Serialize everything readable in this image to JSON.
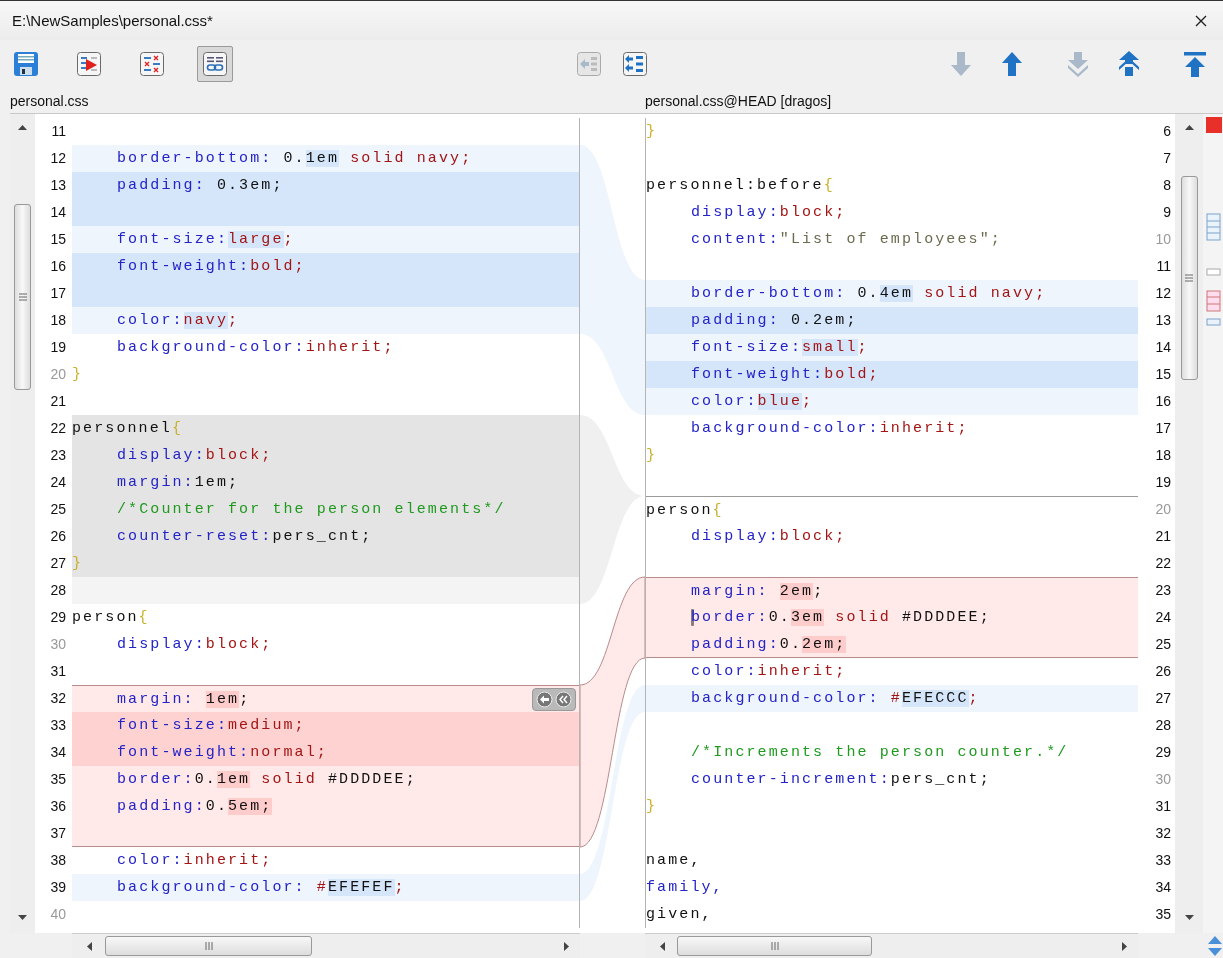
{
  "window": {
    "title": "E:\\NewSamples\\personal.css*"
  },
  "toolbar": {
    "groups": [
      {
        "buttons": [
          {
            "kind": "save",
            "pressed": false,
            "disabled": false
          },
          {
            "kind": "compare",
            "pressed": false,
            "disabled": false
          },
          {
            "kind": "ignore",
            "pressed": false,
            "disabled": false
          },
          {
            "kind": "link",
            "pressed": true,
            "disabled": false
          }
        ]
      },
      {
        "buttons": [
          {
            "kind": "copy-left",
            "pressed": false,
            "disabled": true
          },
          {
            "kind": "copy-all-left",
            "pressed": false,
            "disabled": false
          }
        ]
      },
      {
        "buttons": [
          {
            "kind": "next",
            "pressed": false,
            "disabled": true
          },
          {
            "kind": "prev",
            "pressed": false,
            "disabled": false
          },
          {
            "kind": "next-block",
            "pressed": false,
            "disabled": true
          },
          {
            "kind": "prev-block",
            "pressed": false,
            "disabled": false
          },
          {
            "kind": "first",
            "pressed": false,
            "disabled": false
          }
        ]
      }
    ]
  },
  "left": {
    "label": "personal.css",
    "lines": [
      {
        "number": "11",
        "kind": "plain"
      },
      {
        "number": "12",
        "kind": "change",
        "indent": true,
        "code": [
          {
            "text": "border-bottom:",
            "kind": "key"
          },
          {
            "text": " 0.",
            "kind": "num"
          },
          {
            "text": "1em",
            "kind": "num",
            "highlight": true
          },
          {
            "text": " solid navy;",
            "kind": "val"
          }
        ]
      },
      {
        "number": "13",
        "kind": "change-strong",
        "indent": true,
        "code": [
          {
            "text": "padding:",
            "kind": "key"
          },
          {
            "text": " 0.3em;",
            "kind": "num"
          }
        ]
      },
      {
        "number": "14",
        "kind": "change-strong"
      },
      {
        "number": "15",
        "kind": "change",
        "indent": true,
        "code": [
          {
            "text": "font-size:",
            "kind": "key"
          },
          {
            "text": "large",
            "kind": "val",
            "highlight": true
          },
          {
            "text": ";",
            "kind": "val"
          }
        ]
      },
      {
        "number": "16",
        "kind": "change-strong",
        "indent": true,
        "code": [
          {
            "text": "font-weight:",
            "kind": "key"
          },
          {
            "text": "bold;",
            "kind": "val"
          }
        ]
      },
      {
        "number": "17",
        "kind": "change-strong"
      },
      {
        "number": "18",
        "kind": "change",
        "indent": true,
        "code": [
          {
            "text": "color:",
            "kind": "key"
          },
          {
            "text": "navy",
            "kind": "val",
            "highlight": true
          },
          {
            "text": ";",
            "kind": "val"
          }
        ]
      },
      {
        "number": "19",
        "kind": "plain",
        "indent": true,
        "code": [
          {
            "text": "background-color:",
            "kind": "key"
          },
          {
            "text": "inherit;",
            "kind": "val"
          }
        ]
      },
      {
        "number": "20",
        "kind": "plain",
        "dim": true,
        "code": [
          {
            "text": "}",
            "kind": "brace"
          }
        ]
      },
      {
        "number": "21",
        "kind": "plain"
      },
      {
        "number": "22",
        "kind": "grey",
        "code": [
          {
            "text": "personnel",
            "kind": "sel"
          },
          {
            "text": "{",
            "kind": "brace"
          }
        ]
      },
      {
        "number": "23",
        "kind": "grey",
        "indent": true,
        "code": [
          {
            "text": "display:",
            "kind": "key"
          },
          {
            "text": "block;",
            "kind": "val"
          }
        ]
      },
      {
        "number": "24",
        "kind": "grey",
        "indent": true,
        "code": [
          {
            "text": "margin:",
            "kind": "key"
          },
          {
            "text": "1em;",
            "kind": "num"
          }
        ]
      },
      {
        "number": "25",
        "kind": "grey",
        "indent": true,
        "code": [
          {
            "text": "/*Counter for the person elements*/",
            "kind": "comment"
          }
        ]
      },
      {
        "number": "26",
        "kind": "grey",
        "indent": true,
        "code": [
          {
            "text": "counter-reset:",
            "kind": "key"
          },
          {
            "text": "pers_cnt;",
            "kind": "num"
          }
        ]
      },
      {
        "number": "27",
        "kind": "grey",
        "code": [
          {
            "text": "}",
            "kind": "brace"
          }
        ]
      },
      {
        "number": "28",
        "kind": "grey-light"
      },
      {
        "number": "29",
        "kind": "plain",
        "code": [
          {
            "text": "person",
            "kind": "sel"
          },
          {
            "text": "{",
            "kind": "brace"
          }
        ]
      },
      {
        "number": "30",
        "kind": "plain",
        "dim": true,
        "indent": true,
        "code": [
          {
            "text": "display:",
            "kind": "key"
          },
          {
            "text": "block;",
            "kind": "val"
          }
        ]
      },
      {
        "number": "31",
        "kind": "plain"
      },
      {
        "number": "32",
        "kind": "conflict",
        "indent": true,
        "merge_buttons": true,
        "code": [
          {
            "text": "margin: ",
            "kind": "key"
          },
          {
            "text": "1em",
            "kind": "num",
            "highlight": true
          },
          {
            "text": ";",
            "kind": "num"
          }
        ]
      },
      {
        "number": "33",
        "kind": "conflict-strong",
        "indent": true,
        "code": [
          {
            "text": "font-size:",
            "kind": "key"
          },
          {
            "text": "medium;",
            "kind": "val"
          }
        ]
      },
      {
        "number": "34",
        "kind": "conflict-strong",
        "indent": true,
        "code": [
          {
            "text": "font-weight:",
            "kind": "key"
          },
          {
            "text": "normal;",
            "kind": "val"
          }
        ]
      },
      {
        "number": "35",
        "kind": "conflict",
        "indent": true,
        "code": [
          {
            "text": "border:",
            "kind": "key"
          },
          {
            "text": "0.",
            "kind": "num"
          },
          {
            "text": "1em",
            "kind": "num",
            "highlight": true
          },
          {
            "text": " solid ",
            "kind": "val"
          },
          {
            "text": "#DDDDEE;",
            "kind": "num"
          }
        ]
      },
      {
        "number": "36",
        "kind": "conflict",
        "indent": true,
        "code": [
          {
            "text": "padding:",
            "kind": "key"
          },
          {
            "text": "0.",
            "kind": "num"
          },
          {
            "text": "5em;",
            "kind": "num",
            "highlight": true
          }
        ]
      },
      {
        "number": "37",
        "kind": "conflict"
      },
      {
        "number": "38",
        "kind": "plain",
        "indent": true,
        "code": [
          {
            "text": "color:",
            "kind": "key"
          },
          {
            "text": "inherit;",
            "kind": "val"
          }
        ]
      },
      {
        "number": "39",
        "kind": "change",
        "indent": true,
        "code": [
          {
            "text": "background-color:",
            "kind": "key"
          },
          {
            "text": " #",
            "kind": "val"
          },
          {
            "text": "EFEFEF",
            "kind": "num",
            "highlight": true
          },
          {
            "text": ";",
            "kind": "val"
          }
        ]
      },
      {
        "number": "40",
        "kind": "plain",
        "dim": true
      }
    ]
  },
  "right": {
    "label": "personal.css@HEAD [dragos]",
    "lines": [
      {
        "number": "6",
        "kind": "plain",
        "code": [
          {
            "text": "}",
            "kind": "brace"
          }
        ]
      },
      {
        "number": "7",
        "kind": "plain"
      },
      {
        "number": "8",
        "kind": "plain",
        "code": [
          {
            "text": "personnel:before",
            "kind": "sel"
          },
          {
            "text": "{",
            "kind": "brace"
          }
        ]
      },
      {
        "number": "9",
        "kind": "plain",
        "indent": true,
        "code": [
          {
            "text": "display:",
            "kind": "key"
          },
          {
            "text": "block;",
            "kind": "val"
          }
        ]
      },
      {
        "number": "10",
        "kind": "plain",
        "dim": true,
        "indent": true,
        "code": [
          {
            "text": "content:",
            "kind": "key"
          },
          {
            "text": "\"List of employees\";",
            "kind": "str"
          }
        ]
      },
      {
        "number": "11",
        "kind": "plain"
      },
      {
        "number": "12",
        "kind": "change",
        "indent": true,
        "code": [
          {
            "text": "border-bottom:",
            "kind": "key"
          },
          {
            "text": " 0.",
            "kind": "num"
          },
          {
            "text": "4em",
            "kind": "num",
            "highlight": true
          },
          {
            "text": " solid navy;",
            "kind": "val"
          }
        ]
      },
      {
        "number": "13",
        "kind": "change-strong",
        "indent": true,
        "code": [
          {
            "text": "padding:",
            "kind": "key"
          },
          {
            "text": " 0.2em;",
            "kind": "num"
          }
        ]
      },
      {
        "number": "14",
        "kind": "change",
        "indent": true,
        "code": [
          {
            "text": "font-size:",
            "kind": "key"
          },
          {
            "text": "small",
            "kind": "val",
            "highlight": true
          },
          {
            "text": ";",
            "kind": "val"
          }
        ]
      },
      {
        "number": "15",
        "kind": "change-strong",
        "indent": true,
        "code": [
          {
            "text": "font-weight:",
            "kind": "key"
          },
          {
            "text": "bold;",
            "kind": "val"
          }
        ]
      },
      {
        "number": "16",
        "kind": "change",
        "indent": true,
        "code": [
          {
            "text": "color:",
            "kind": "key"
          },
          {
            "text": "blue",
            "kind": "val",
            "highlight": true
          },
          {
            "text": ";",
            "kind": "val"
          }
        ]
      },
      {
        "number": "17",
        "kind": "plain",
        "indent": true,
        "code": [
          {
            "text": "background-color:",
            "kind": "key"
          },
          {
            "text": "inherit;",
            "kind": "val"
          }
        ]
      },
      {
        "number": "18",
        "kind": "plain",
        "code": [
          {
            "text": "}",
            "kind": "brace"
          }
        ]
      },
      {
        "number": "19",
        "kind": "plain"
      },
      {
        "number": "20",
        "kind": "plain",
        "dim": true,
        "divider": true,
        "code": [
          {
            "text": "person",
            "kind": "sel"
          },
          {
            "text": "{",
            "kind": "brace"
          }
        ]
      },
      {
        "number": "21",
        "kind": "plain",
        "indent": true,
        "code": [
          {
            "text": "display:",
            "kind": "key"
          },
          {
            "text": "block;",
            "kind": "val"
          }
        ]
      },
      {
        "number": "22",
        "kind": "plain"
      },
      {
        "number": "23",
        "kind": "conflict",
        "indent": true,
        "code": [
          {
            "text": "margin: ",
            "kind": "key"
          },
          {
            "text": "2em",
            "kind": "num",
            "highlight": true
          },
          {
            "text": ";",
            "kind": "num"
          }
        ]
      },
      {
        "number": "24",
        "kind": "conflict",
        "indent": true,
        "caret": true,
        "code": [
          {
            "text": "border:",
            "kind": "key"
          },
          {
            "text": "0.",
            "kind": "num"
          },
          {
            "text": "3em",
            "kind": "num",
            "highlight": true
          },
          {
            "text": " solid ",
            "kind": "val"
          },
          {
            "text": "#DDDDEE;",
            "kind": "num"
          }
        ]
      },
      {
        "number": "25",
        "kind": "conflict",
        "indent": true,
        "code": [
          {
            "text": "padding:",
            "kind": "key"
          },
          {
            "text": "0.",
            "kind": "num"
          },
          {
            "text": "2em;",
            "kind": "num",
            "highlight": true
          }
        ]
      },
      {
        "number": "26",
        "kind": "plain",
        "indent": true,
        "code": [
          {
            "text": "color:",
            "kind": "key"
          },
          {
            "text": "inherit;",
            "kind": "val"
          }
        ]
      },
      {
        "number": "27",
        "kind": "change",
        "indent": true,
        "code": [
          {
            "text": "background-color:",
            "kind": "key"
          },
          {
            "text": " #",
            "kind": "val"
          },
          {
            "text": "EFECCC",
            "kind": "num",
            "highlight": true
          },
          {
            "text": ";",
            "kind": "val"
          }
        ]
      },
      {
        "number": "28",
        "kind": "plain"
      },
      {
        "number": "29",
        "kind": "plain",
        "indent": true,
        "code": [
          {
            "text": "/*Increments the person counter.*/",
            "kind": "comment"
          }
        ]
      },
      {
        "number": "30",
        "kind": "plain",
        "dim": true,
        "indent": true,
        "code": [
          {
            "text": "counter-increment:",
            "kind": "key"
          },
          {
            "text": "pers_cnt;",
            "kind": "num"
          }
        ]
      },
      {
        "number": "31",
        "kind": "plain",
        "code": [
          {
            "text": "}",
            "kind": "brace"
          }
        ]
      },
      {
        "number": "32",
        "kind": "plain"
      },
      {
        "number": "33",
        "kind": "plain",
        "code": [
          {
            "text": "name,",
            "kind": "sel"
          }
        ]
      },
      {
        "number": "34",
        "kind": "plain",
        "code": [
          {
            "text": "family,",
            "kind": "key"
          }
        ]
      },
      {
        "number": "35",
        "kind": "plain",
        "code": [
          {
            "text": "given,",
            "kind": "sel"
          }
        ]
      }
    ]
  }
}
